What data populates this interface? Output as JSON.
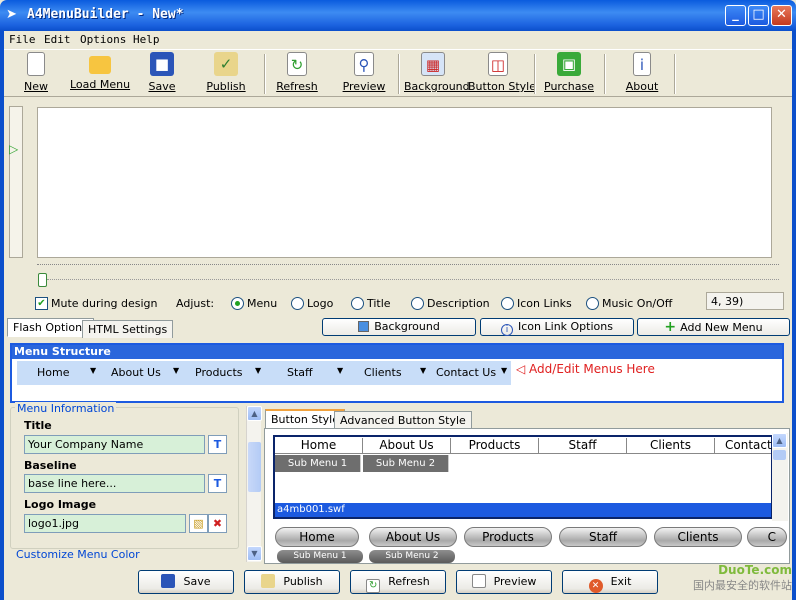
{
  "window": {
    "title": "A4MenuBuilder - New*"
  },
  "menubar": [
    "File",
    "Edit",
    "Options",
    "Help"
  ],
  "toolbar": {
    "new": "New",
    "load_menu": "Load Menu",
    "save": "Save",
    "publish": "Publish",
    "refresh": "Refresh",
    "preview": "Preview",
    "background": "Background",
    "button_style": "Button Style",
    "purchase": "Purchase",
    "about": "About"
  },
  "options": {
    "mute_label": "Mute during design",
    "mute_checked": true,
    "adjust_label": "Adjust:",
    "radios": [
      "Menu",
      "Logo",
      "Title",
      "Description",
      "Icon Links",
      "Music On/Off"
    ],
    "selected": "Menu",
    "coords": "4, 39)"
  },
  "tabs": {
    "flash": "Flash Options",
    "html": "HTML Settings"
  },
  "actions": {
    "background": "Background",
    "icon_link_options": "Icon Link Options",
    "add_new_menu": "Add New Menu"
  },
  "menu_structure": {
    "header": "Menu Structure",
    "items": [
      "Home",
      "About Us",
      "Products",
      "Staff",
      "Clients",
      "Contact Us"
    ],
    "hint": "Add/Edit Menus Here"
  },
  "menu_info": {
    "group_title": "Menu Information",
    "title_label": "Title",
    "title_value": "Your Company Name",
    "baseline_label": "Baseline",
    "baseline_value": "base line here...",
    "logo_label": "Logo Image",
    "logo_value": "logo1.jpg",
    "customize_color": "Customize Menu Color"
  },
  "style_tabs": {
    "button_style": "Button Style",
    "advanced": "Advanced Button Style"
  },
  "style_preview": {
    "items": [
      "Home",
      "About Us",
      "Products",
      "Staff",
      "Clients",
      "Contact"
    ],
    "subs": [
      "Sub Menu 1",
      "Sub Menu 2"
    ],
    "file": "a4mb001.swf"
  },
  "pill_preview": {
    "items": [
      "Home",
      "About Us",
      "Products",
      "Staff",
      "Clients",
      "C"
    ],
    "subs": [
      "Sub Menu 1",
      "Sub Menu 2"
    ]
  },
  "bottom": {
    "save": "Save",
    "publish": "Publish",
    "refresh": "Refresh",
    "preview": "Preview",
    "exit": "Exit"
  },
  "watermark": {
    "brand": "DuoTe.com",
    "text": "国内最安全的软件站"
  }
}
